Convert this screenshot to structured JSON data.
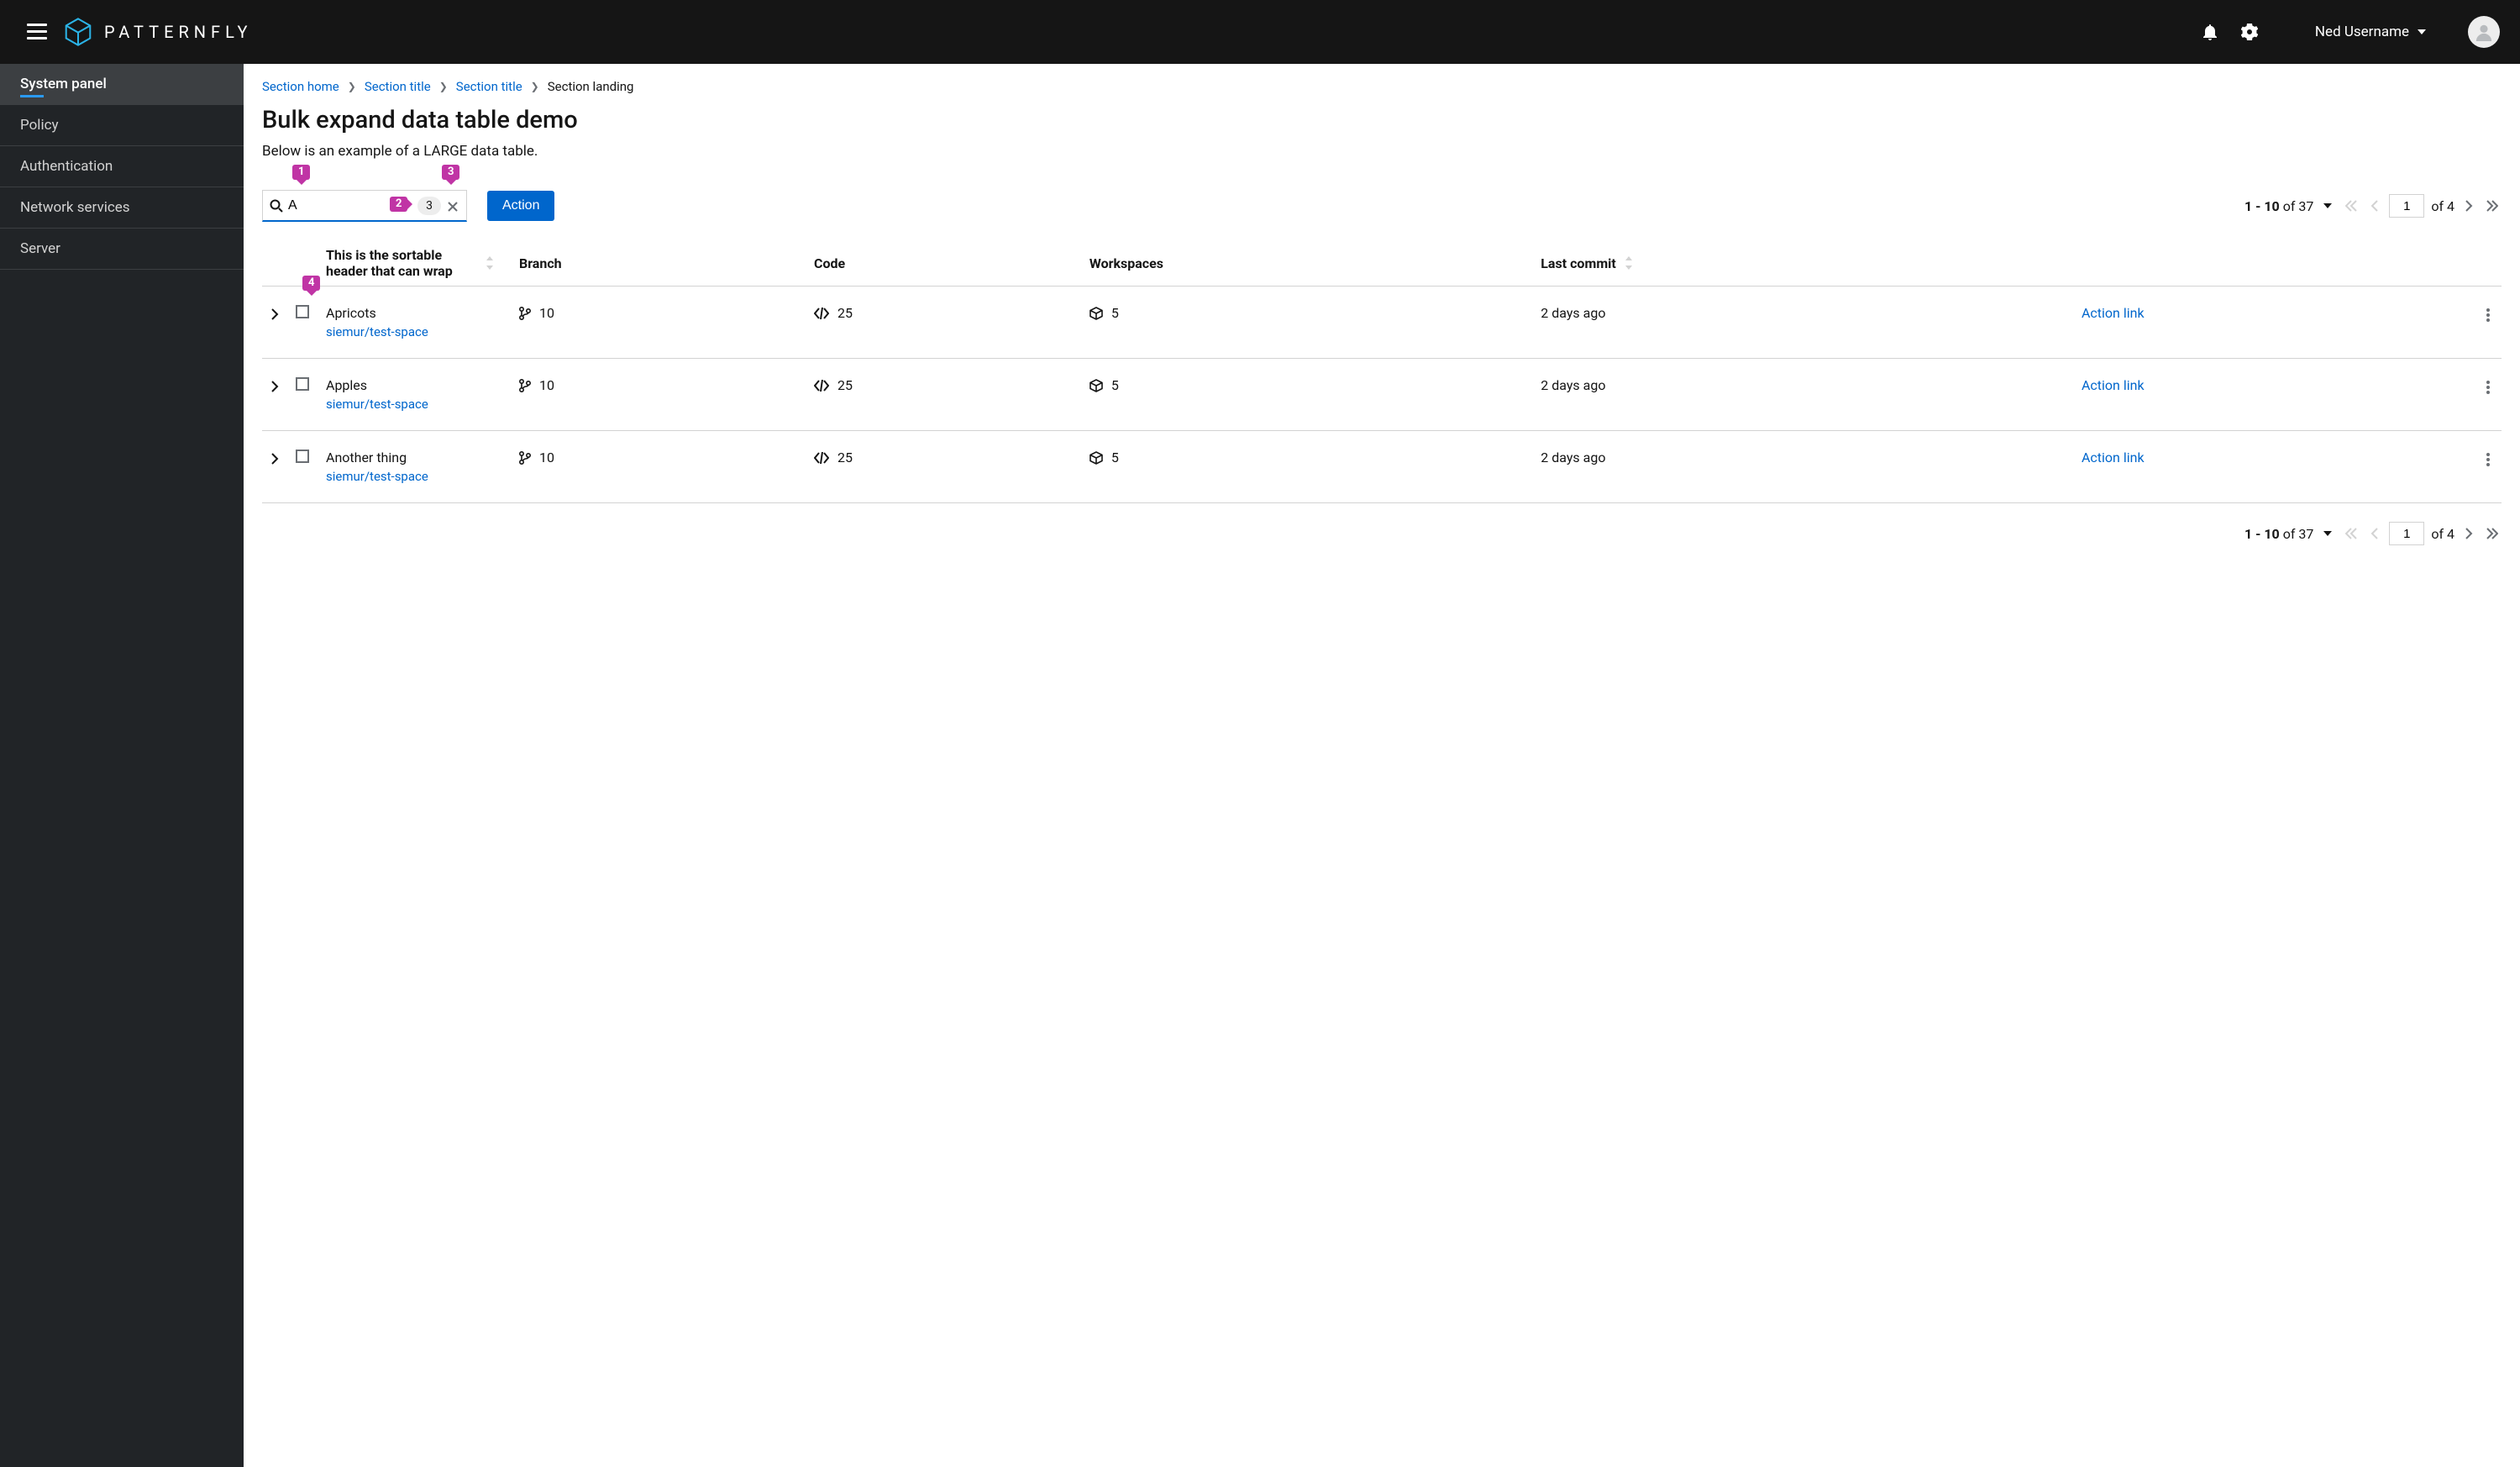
{
  "brand": {
    "name": "PATTERNFLY"
  },
  "header": {
    "username": "Ned Username"
  },
  "sidebar": {
    "items": [
      {
        "label": "System panel",
        "active": true
      },
      {
        "label": "Policy",
        "active": false
      },
      {
        "label": "Authentication",
        "active": false
      },
      {
        "label": "Network services",
        "active": false
      },
      {
        "label": "Server",
        "active": false
      }
    ]
  },
  "breadcrumb": {
    "items": [
      {
        "label": "Section home",
        "link": true
      },
      {
        "label": "Section title",
        "link": true
      },
      {
        "label": "Section title",
        "link": true
      },
      {
        "label": "Section landing",
        "link": false
      }
    ]
  },
  "page": {
    "title": "Bulk expand data table demo",
    "description": "Below is an example of a LARGE data table."
  },
  "toolbar": {
    "search_value": "A",
    "search_badge": "3",
    "action_label": "Action"
  },
  "callouts": {
    "c1": "1",
    "c2": "2",
    "c3": "3",
    "c4": "4"
  },
  "pagination_top": {
    "range_text": "1 - 10 of 37",
    "page_value": "1",
    "of_pages": "of 4"
  },
  "pagination_bottom": {
    "range_text": "1 - 10 of 37",
    "page_value": "1",
    "of_pages": "of 4"
  },
  "table": {
    "columns": {
      "c1": "This is the sortable header that can wrap",
      "c2": "Branch",
      "c3": "Code",
      "c4": "Workspaces",
      "c5": "Last commit"
    },
    "action_link_label": "Action link",
    "rows": [
      {
        "name": "Apricots",
        "sublink": "siemur/test-space",
        "branch": "10",
        "code": "25",
        "workspaces": "5",
        "last_commit": "2 days ago"
      },
      {
        "name": "Apples",
        "sublink": "siemur/test-space",
        "branch": "10",
        "code": "25",
        "workspaces": "5",
        "last_commit": "2 days ago"
      },
      {
        "name": "Another thing",
        "sublink": "siemur/test-space",
        "branch": "10",
        "code": "25",
        "workspaces": "5",
        "last_commit": "2 days ago"
      }
    ]
  }
}
